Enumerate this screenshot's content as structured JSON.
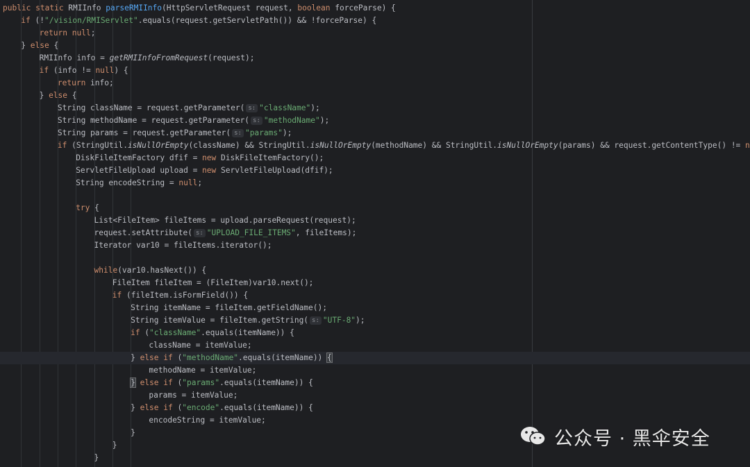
{
  "watermark": {
    "text": "公众号 · 黑伞安全",
    "icon": "wechat-icon"
  },
  "colors": {
    "background": "#1e1f22",
    "keyword": "#cf8e6d",
    "string": "#6aab73",
    "method_declaration": "#56a8f5",
    "text": "#bcbec4",
    "hint": "#8c8f94"
  },
  "code_lines": [
    {
      "indent": 0,
      "tokens": [
        [
          "kw",
          "public static "
        ],
        [
          "txt",
          "RMIInfo "
        ],
        [
          "fn",
          "parseRMIInfo"
        ],
        [
          "txt",
          "(HttpServletRequest request, "
        ],
        [
          "kw",
          "boolean "
        ],
        [
          "txt",
          "forceParse) {"
        ]
      ]
    },
    {
      "indent": 1,
      "tokens": [
        [
          "kw",
          "if "
        ],
        [
          "txt",
          "(!"
        ],
        [
          "str",
          "\"/vision/RMIServlet\""
        ],
        [
          "txt",
          ".equals(request.getServletPath()) && !forceParse) {"
        ]
      ]
    },
    {
      "indent": 2,
      "tokens": [
        [
          "kw",
          "return null"
        ],
        [
          "txt",
          ";"
        ]
      ]
    },
    {
      "indent": 1,
      "tokens": [
        [
          "txt",
          "} "
        ],
        [
          "kw",
          "else "
        ],
        [
          "txt",
          "{"
        ]
      ]
    },
    {
      "indent": 2,
      "tokens": [
        [
          "txt",
          "RMIInfo info = "
        ],
        [
          "it",
          "getRMIInfoFromRequest"
        ],
        [
          "txt",
          "(request);"
        ]
      ]
    },
    {
      "indent": 2,
      "tokens": [
        [
          "kw",
          "if "
        ],
        [
          "txt",
          "(info != "
        ],
        [
          "kw",
          "null"
        ],
        [
          "txt",
          ") {"
        ]
      ]
    },
    {
      "indent": 3,
      "tokens": [
        [
          "kw",
          "return "
        ],
        [
          "txt",
          "info;"
        ]
      ]
    },
    {
      "indent": 2,
      "tokens": [
        [
          "txt",
          "} "
        ],
        [
          "kw",
          "else "
        ],
        [
          "txt",
          "{"
        ]
      ]
    },
    {
      "indent": 3,
      "tokens": [
        [
          "txt",
          "String className = request.getParameter("
        ],
        [
          "hint",
          "s:"
        ],
        [
          "str",
          "\"className\""
        ],
        [
          "txt",
          ");"
        ]
      ]
    },
    {
      "indent": 3,
      "tokens": [
        [
          "txt",
          "String methodName = request.getParameter("
        ],
        [
          "hint",
          "s:"
        ],
        [
          "str",
          "\"methodName\""
        ],
        [
          "txt",
          ");"
        ]
      ]
    },
    {
      "indent": 3,
      "tokens": [
        [
          "txt",
          "String params = request.getParameter("
        ],
        [
          "hint",
          "s:"
        ],
        [
          "str",
          "\"params\""
        ],
        [
          "txt",
          ");"
        ]
      ]
    },
    {
      "indent": 3,
      "tokens": [
        [
          "kw",
          "if "
        ],
        [
          "txt",
          "(StringUtil."
        ],
        [
          "it",
          "isNullOrEmpty"
        ],
        [
          "txt",
          "(className) && StringUtil."
        ],
        [
          "it",
          "isNullOrEmpty"
        ],
        [
          "txt",
          "(methodName) && StringUtil."
        ],
        [
          "it",
          "isNullOrEmpty"
        ],
        [
          "txt",
          "(params) && request.getContentType() != "
        ],
        [
          "kw",
          "null"
        ]
      ]
    },
    {
      "indent": 4,
      "tokens": [
        [
          "txt",
          "DiskFileItemFactory dfif = "
        ],
        [
          "kw",
          "new "
        ],
        [
          "txt",
          "DiskFileItemFactory();"
        ]
      ]
    },
    {
      "indent": 4,
      "tokens": [
        [
          "txt",
          "ServletFileUpload upload = "
        ],
        [
          "kw",
          "new "
        ],
        [
          "txt",
          "ServletFileUpload(dfif);"
        ]
      ]
    },
    {
      "indent": 4,
      "tokens": [
        [
          "txt",
          "String encodeString = "
        ],
        [
          "kw",
          "null"
        ],
        [
          "txt",
          ";"
        ]
      ]
    },
    {
      "indent": 0,
      "tokens": []
    },
    {
      "indent": 4,
      "tokens": [
        [
          "kw",
          "try "
        ],
        [
          "txt",
          "{"
        ]
      ]
    },
    {
      "indent": 5,
      "tokens": [
        [
          "txt",
          "List<FileItem> fileItems = upload.parseRequest(request);"
        ]
      ]
    },
    {
      "indent": 5,
      "tokens": [
        [
          "txt",
          "request.setAttribute("
        ],
        [
          "hint",
          "s:"
        ],
        [
          "str",
          "\"UPLOAD_FILE_ITEMS\""
        ],
        [
          "txt",
          ", fileItems);"
        ]
      ]
    },
    {
      "indent": 5,
      "tokens": [
        [
          "txt",
          "Iterator var10 = fileItems.iterator();"
        ]
      ]
    },
    {
      "indent": 0,
      "tokens": []
    },
    {
      "indent": 5,
      "tokens": [
        [
          "kw",
          "while"
        ],
        [
          "txt",
          "(var10.hasNext()) {"
        ]
      ]
    },
    {
      "indent": 6,
      "tokens": [
        [
          "txt",
          "FileItem fileItem = (FileItem)var10.next();"
        ]
      ]
    },
    {
      "indent": 6,
      "tokens": [
        [
          "kw",
          "if "
        ],
        [
          "txt",
          "(fileItem.isFormField()) {"
        ]
      ]
    },
    {
      "indent": 7,
      "tokens": [
        [
          "txt",
          "String itemName = fileItem.getFieldName();"
        ]
      ]
    },
    {
      "indent": 7,
      "tokens": [
        [
          "txt",
          "String itemValue = fileItem.getString("
        ],
        [
          "hint",
          "s:"
        ],
        [
          "str",
          "\"UTF-8\""
        ],
        [
          "txt",
          ");"
        ]
      ]
    },
    {
      "indent": 7,
      "tokens": [
        [
          "kw",
          "if "
        ],
        [
          "txt",
          "("
        ],
        [
          "str",
          "\"className\""
        ],
        [
          "txt",
          ".equals(itemName)) {"
        ]
      ]
    },
    {
      "indent": 8,
      "tokens": [
        [
          "txt",
          "className = itemValue;"
        ]
      ]
    },
    {
      "indent": 7,
      "current": true,
      "tokens": [
        [
          "txt",
          "} "
        ],
        [
          "kw",
          "else if "
        ],
        [
          "txt",
          "("
        ],
        [
          "str",
          "\"methodName\""
        ],
        [
          "txt",
          ".equals(itemName)) "
        ],
        [
          "brace",
          "{"
        ]
      ]
    },
    {
      "indent": 8,
      "tokens": [
        [
          "txt",
          "methodName = itemValue;"
        ]
      ]
    },
    {
      "indent": 7,
      "tokens": [
        [
          "brace",
          "}"
        ],
        [
          "txt",
          " "
        ],
        [
          "kw",
          "else if "
        ],
        [
          "txt",
          "("
        ],
        [
          "str",
          "\"params\""
        ],
        [
          "txt",
          ".equals(itemName)) {"
        ]
      ]
    },
    {
      "indent": 8,
      "tokens": [
        [
          "txt",
          "params = itemValue;"
        ]
      ]
    },
    {
      "indent": 7,
      "tokens": [
        [
          "txt",
          "} "
        ],
        [
          "kw",
          "else if "
        ],
        [
          "txt",
          "("
        ],
        [
          "str",
          "\"encode\""
        ],
        [
          "txt",
          ".equals(itemName)) {"
        ]
      ]
    },
    {
      "indent": 8,
      "tokens": [
        [
          "txt",
          "encodeString = itemValue;"
        ]
      ]
    },
    {
      "indent": 7,
      "tokens": [
        [
          "txt",
          "}"
        ]
      ]
    },
    {
      "indent": 6,
      "tokens": [
        [
          "txt",
          "}"
        ]
      ]
    },
    {
      "indent": 5,
      "tokens": [
        [
          "txt",
          "}"
        ]
      ]
    }
  ]
}
